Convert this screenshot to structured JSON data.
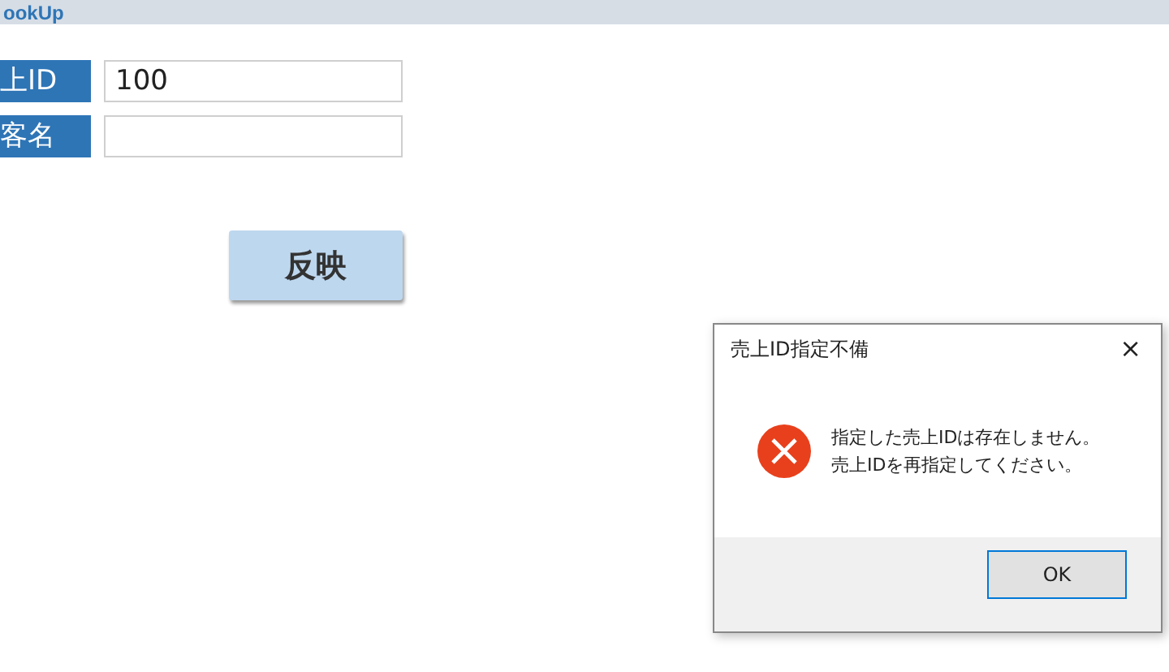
{
  "header": {
    "title": "ookUp"
  },
  "fields": [
    {
      "label": "上ID",
      "value": "100"
    },
    {
      "label": "客名"
    }
  ],
  "apply_button": "反映",
  "dialog": {
    "title": "売上ID指定不備",
    "close": "×",
    "kind": "error",
    "message_lines": [
      "指定した売上IDは存在しません。",
      "売上IDを再指定してください。"
    ],
    "ok_button": "OK"
  }
}
